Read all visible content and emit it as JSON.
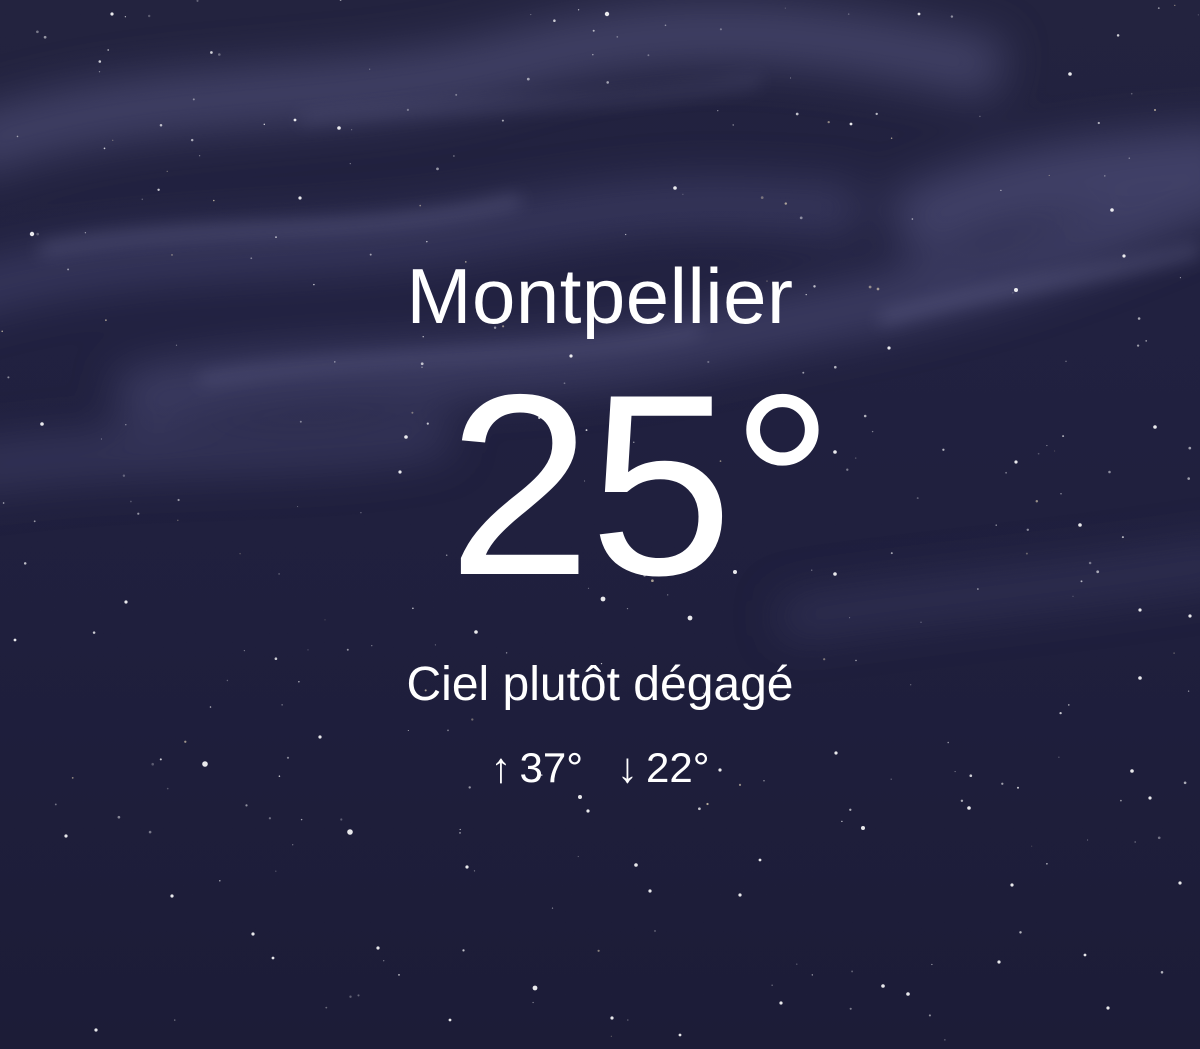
{
  "weather": {
    "city": "Montpellier",
    "temperature": "25°",
    "condition": "Ciel plutôt dégagé",
    "high_arrow": "↑",
    "high": "37°",
    "low_arrow": "↓",
    "low": "22°"
  },
  "theme": {
    "background": "#21213f",
    "text_color": "#ffffff"
  }
}
